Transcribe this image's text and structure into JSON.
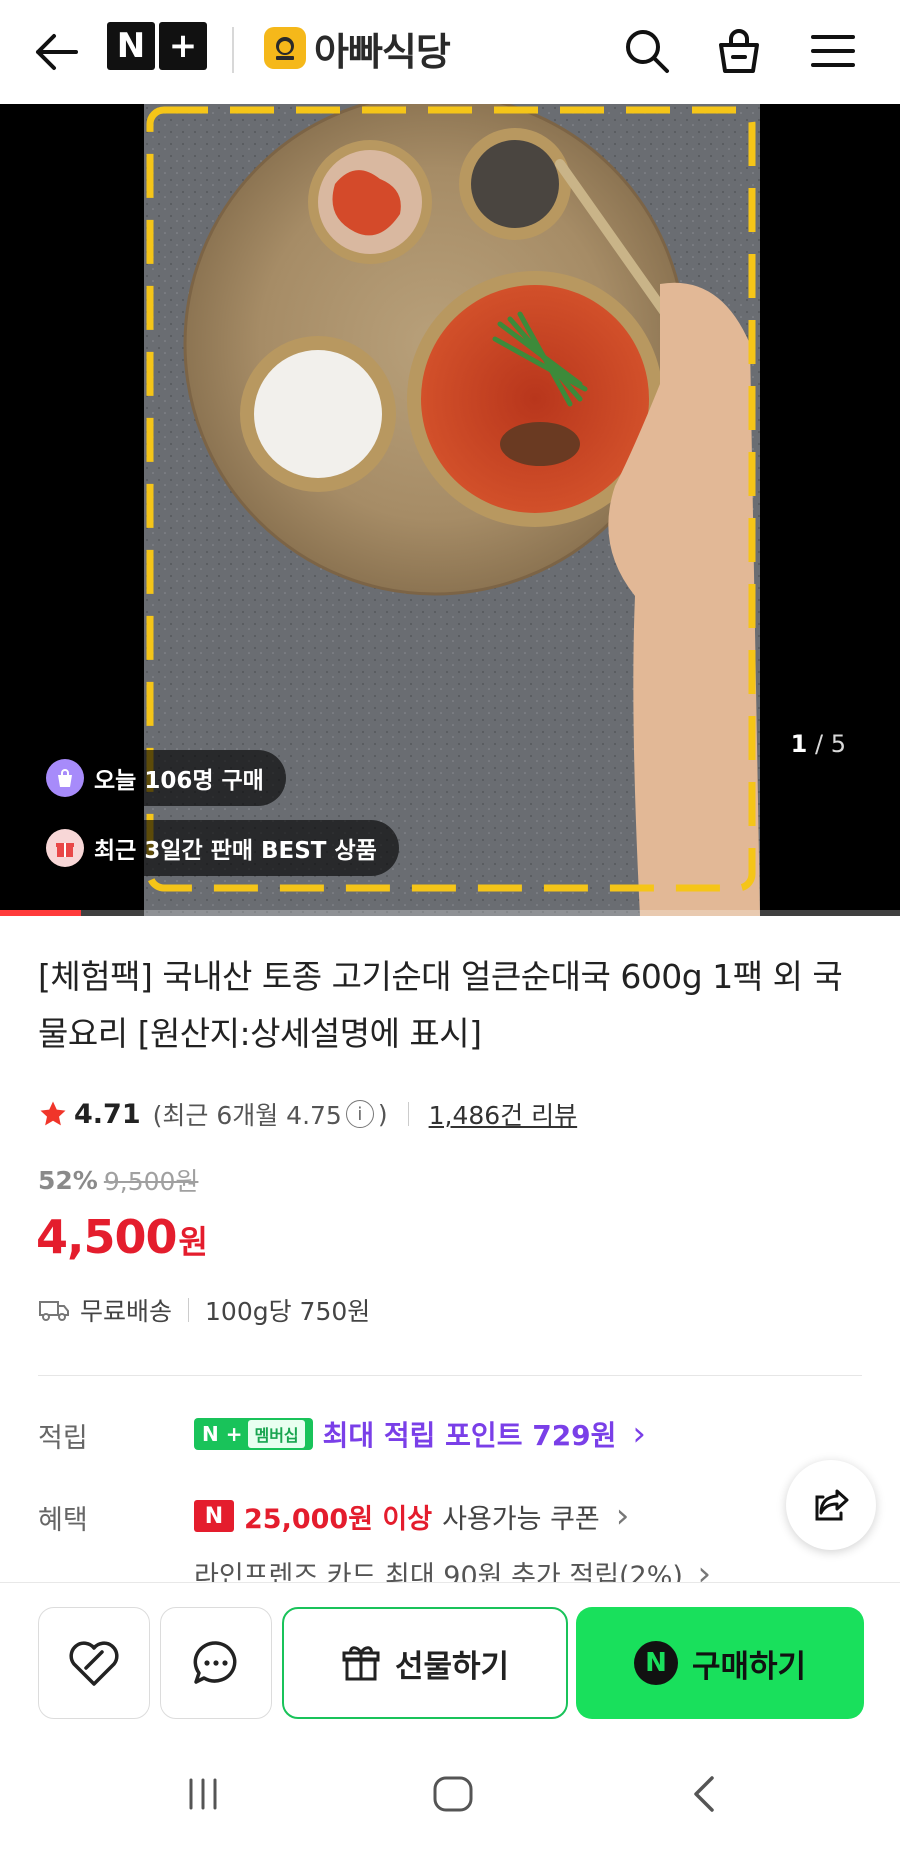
{
  "header": {
    "nplus_logo": [
      "N",
      "+"
    ],
    "store_name": "아빠식당",
    "icons": [
      "back-arrow-icon",
      "search-icon",
      "shopping-bag-icon",
      "hamburger-menu-icon"
    ]
  },
  "hero": {
    "badge_today": "오늘 106명 구매",
    "badge_best": "최근 3일간 판매 BEST 상품",
    "page_current": "1",
    "page_total": "/ 5",
    "slide_progress": 0.09
  },
  "product": {
    "title": "[체험팩] 국내산 토종 고기순대 얼큰순대국 600g 1팩 외 국물요리 [원산지:상세설명에 표시]",
    "rating": "4.71",
    "recent_rating_prefix": "(최근 6개월 4.75",
    "recent_rating_suffix": ")",
    "info_symbol": "i",
    "reviews": "1,486건 리뷰",
    "discount_pct": "52%",
    "original_price": "9,500원",
    "price": "4,500",
    "price_unit": "원",
    "shipping": "무료배송",
    "unit_price": "100g당 750원"
  },
  "benefits": {
    "points_label": "적립",
    "membership_badge_n": "N +",
    "membership_badge_text": "멤버십",
    "points_text": "최대 적립 포인트 729원",
    "benefit_label": "혜택",
    "coupon_n": "N",
    "coupon_amount": "25,000원 이상",
    "coupon_text": "사용가능 쿠폰",
    "card_text": "라인프렌즈 카드 최대 90원 추가 적립(2%)",
    "chevron": "›"
  },
  "actions": {
    "gift_label": "선물하기",
    "buy_n": "N",
    "buy_label": "구매하기"
  },
  "colors": {
    "price_red": "#e41d2d",
    "naver_green": "#19e05c",
    "points_purple": "#7a3fe8",
    "frame_yellow": "#f5c518"
  }
}
